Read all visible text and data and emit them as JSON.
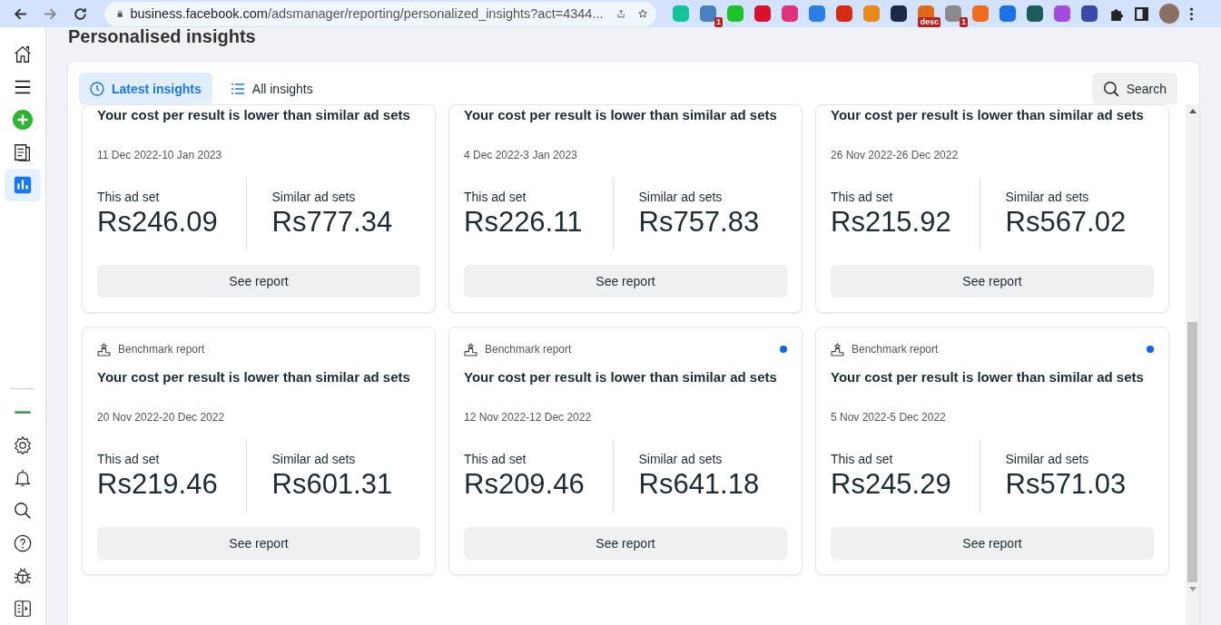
{
  "browser": {
    "url_host": "business.facebook.com",
    "url_path": "/adsmanager/reporting/personalized_insights?act=4344...",
    "extensions": [
      {
        "color": "#15c39a"
      },
      {
        "color": "#4a7fc1",
        "badge": "1"
      },
      {
        "color": "#1cc429"
      },
      {
        "color": "#d9112a"
      },
      {
        "color": "#e0337c"
      },
      {
        "color": "#2a7fe6"
      },
      {
        "color": "#d62a12"
      },
      {
        "color": "#e88a1a"
      },
      {
        "color": "#1b2a4a"
      },
      {
        "color": "#e06a1a",
        "badge": "desc"
      },
      {
        "color": "#8a8a8a",
        "badge": "1"
      },
      {
        "color": "#f26a1b"
      },
      {
        "color": "#1a73e8"
      },
      {
        "color": "#1d5a5a"
      },
      {
        "color": "#a34be0"
      },
      {
        "color": "#3b4aa8"
      }
    ]
  },
  "sidebar": {
    "items": [
      {
        "selected": false
      },
      {
        "selected": false
      },
      {
        "selected": false
      },
      {
        "selected": false
      },
      {
        "selected": true
      }
    ]
  },
  "page_title": "Personalised insights",
  "tabs": [
    {
      "label": "Latest insights",
      "selected": true
    },
    {
      "label": "All insights",
      "selected": false
    }
  ],
  "search": {
    "label": "Search"
  },
  "cards": [
    {
      "title": "Your cost per result is lower than similar ad sets",
      "dates": "11 Dec 2022-10 Jan 2023",
      "this_label": "This ad set",
      "this_value": "Rs246.09",
      "similar_label": "Similar ad sets",
      "similar_value": "Rs777.34",
      "button": "See report"
    },
    {
      "title": "Your cost per result is lower than similar ad sets",
      "dates": "4 Dec 2022-3 Jan 2023",
      "this_label": "This ad set",
      "this_value": "Rs226.11",
      "similar_label": "Similar ad sets",
      "similar_value": "Rs757.83",
      "button": "See report"
    },
    {
      "title": "Your cost per result is lower than similar ad sets",
      "dates": "26 Nov 2022-26 Dec 2022",
      "this_label": "This ad set",
      "this_value": "Rs215.92",
      "similar_label": "Similar ad sets",
      "similar_value": "Rs567.02",
      "button": "See report"
    },
    {
      "label": "Benchmark report",
      "unread": false,
      "title": "Your cost per result is lower than similar ad sets",
      "dates": "20 Nov 2022-20 Dec 2022",
      "this_label": "This ad set",
      "this_value": "Rs219.46",
      "similar_label": "Similar ad sets",
      "similar_value": "Rs601.31",
      "button": "See report"
    },
    {
      "label": "Benchmark report",
      "unread": true,
      "title": "Your cost per result is lower than similar ad sets",
      "dates": "12 Nov 2022-12 Dec 2022",
      "this_label": "This ad set",
      "this_value": "Rs209.46",
      "similar_label": "Similar ad sets",
      "similar_value": "Rs641.18",
      "button": "See report"
    },
    {
      "label": "Benchmark report",
      "unread": true,
      "title": "Your cost per result is lower than similar ad sets",
      "dates": "5 Nov 2022-5 Dec 2022",
      "this_label": "This ad set",
      "this_value": "Rs245.29",
      "similar_label": "Similar ad sets",
      "similar_value": "Rs571.03",
      "button": "See report"
    }
  ]
}
